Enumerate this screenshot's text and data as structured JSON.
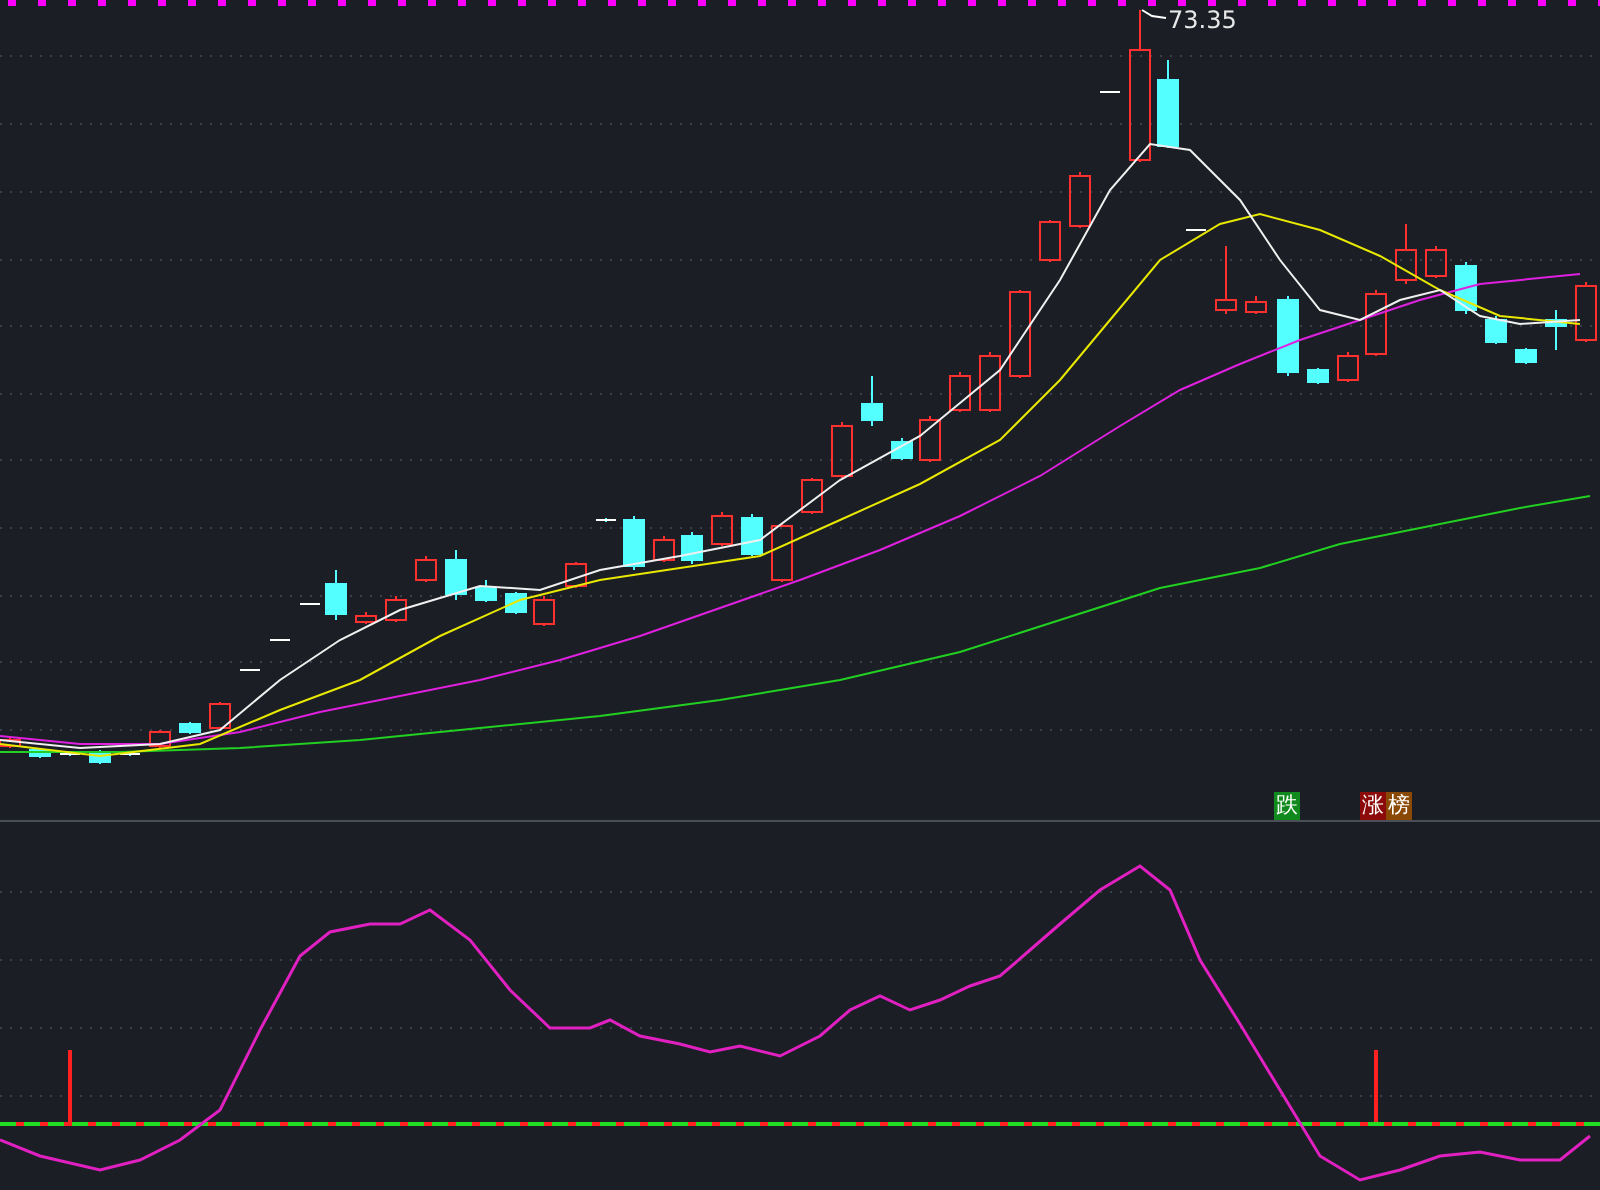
{
  "price_chart": {
    "high_label": "73.35"
  },
  "badges": [
    {
      "text": "跌",
      "color": "#108a1c"
    },
    {
      "text": "涨",
      "color": "#8c0a0a"
    },
    {
      "text": "榜",
      "color": "#8a4a06"
    }
  ]
}
